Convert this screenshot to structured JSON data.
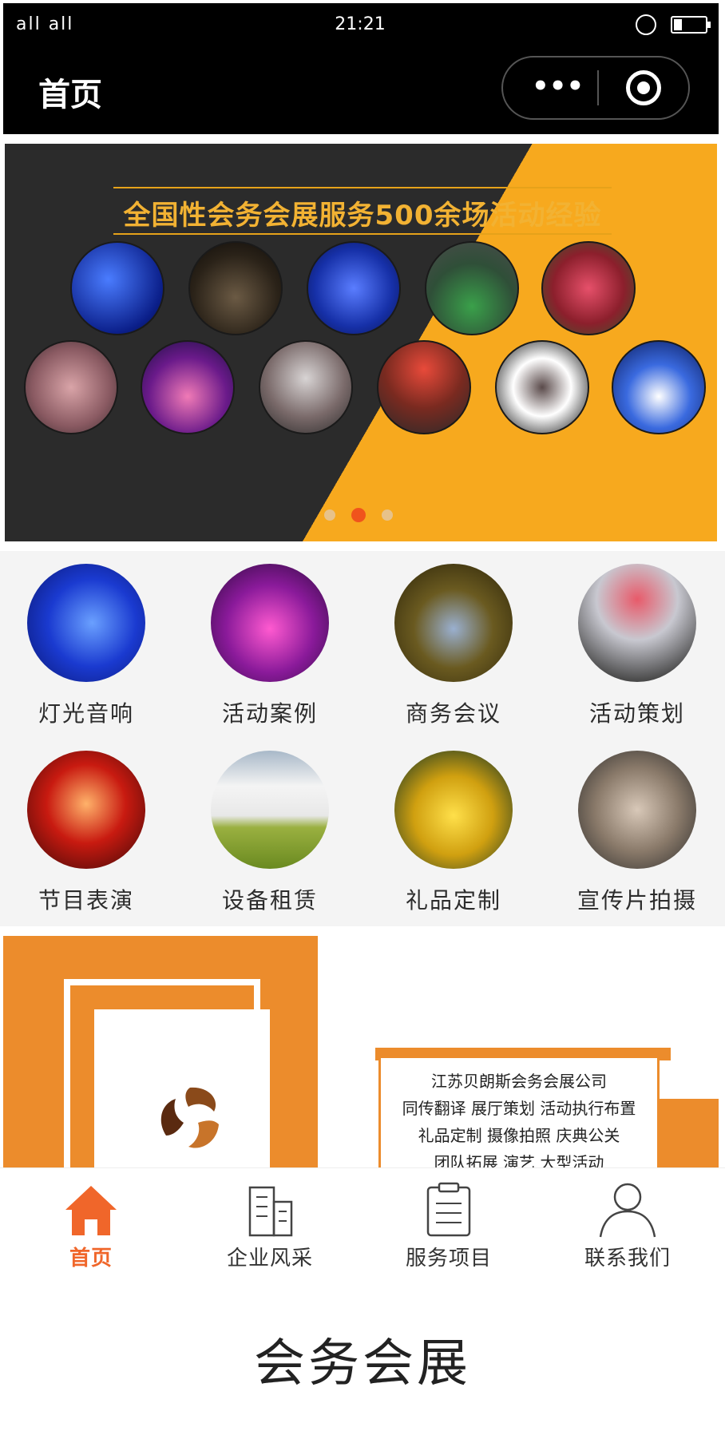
{
  "status_bar": {
    "signal": "all all",
    "time": "21:21"
  },
  "nav": {
    "title": "首页",
    "more_label": "•••"
  },
  "banner": {
    "title": "全国性会务会展服务500余场活动经验",
    "active_slide": 2,
    "slide_count": 3
  },
  "categories": [
    {
      "label": "灯光音响",
      "icon": "stage-light-photo"
    },
    {
      "label": "活动案例",
      "icon": "event-case-photo"
    },
    {
      "label": "商务会议",
      "icon": "business-meeting-photo"
    },
    {
      "label": "活动策划",
      "icon": "event-planning-photo"
    },
    {
      "label": "节目表演",
      "icon": "performance-photo"
    },
    {
      "label": "设备租赁",
      "icon": "equipment-rental-photo"
    },
    {
      "label": "礼品定制",
      "icon": "gift-custom-photo"
    },
    {
      "label": "宣传片拍摄",
      "icon": "promo-video-photo"
    }
  ],
  "company": {
    "lines": [
      "江苏贝朗斯会务会展公司",
      "同传翻译 展厅策划 活动执行布置",
      "礼品定制 摄像拍照 庆典公关",
      "团队拓展 演艺 大型活动"
    ]
  },
  "tabbar": [
    {
      "label": "首页",
      "icon": "home-icon",
      "active": true
    },
    {
      "label": "企业风采",
      "icon": "building-icon",
      "active": false
    },
    {
      "label": "服务项目",
      "icon": "clipboard-icon",
      "active": false
    },
    {
      "label": "联系我们",
      "icon": "user-icon",
      "active": false
    }
  ],
  "footer": {
    "title": "会务会展"
  },
  "colors": {
    "accent": "#f0662a",
    "banner_yellow": "#f7a91e",
    "company_orange": "#ec8c2c"
  }
}
